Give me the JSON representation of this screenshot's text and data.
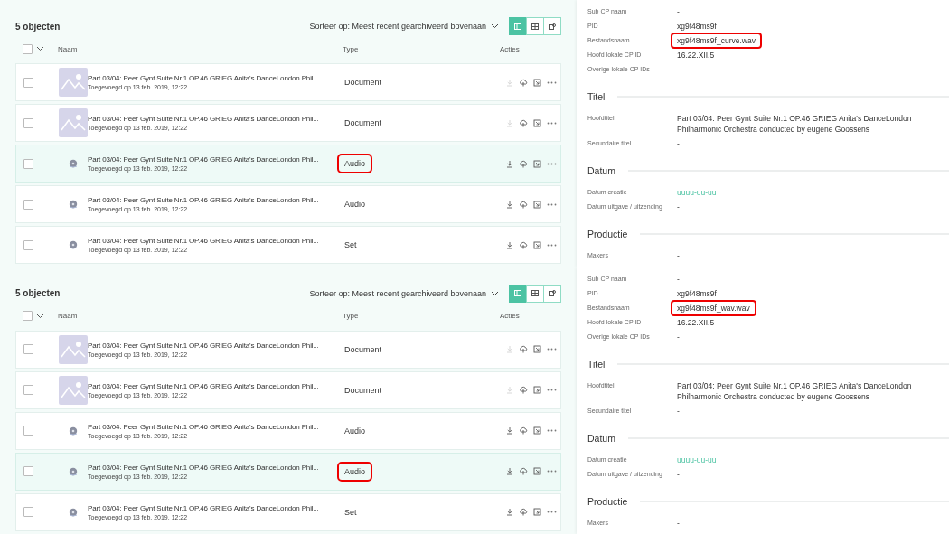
{
  "panels": [
    {
      "list": {
        "count": "5 objecten",
        "sort": "Sorteer op: Meest recent gearchiveerd bovenaan",
        "views": [
          {
            "kind": "list",
            "selected": true
          },
          {
            "kind": "grid",
            "selected": false
          },
          {
            "kind": "gallery",
            "selected": false
          }
        ],
        "select_all_checked": false,
        "columns": [
          "Naam",
          "Type",
          "Acties"
        ],
        "rows": [
          {
            "kind": "image",
            "checked": false,
            "title": "Part 03/04: Peer Gynt Suite Nr.1 OP.46 GRIEG Anita's DanceLondon Phil...",
            "added": "Toegevoegd op 13 feb. 2019, 12:22",
            "type": "Document",
            "selected": false,
            "highlighted": false,
            "download_disabled": true
          },
          {
            "kind": "image",
            "checked": false,
            "title": "Part 03/04: Peer Gynt Suite Nr.1 OP.46 GRIEG Anita's DanceLondon Phil...",
            "added": "Toegevoegd op 13 feb. 2019, 12:22",
            "type": "Document",
            "selected": false,
            "highlighted": false,
            "download_disabled": true
          },
          {
            "kind": "audio",
            "checked": false,
            "title": "Part 03/04: Peer Gynt Suite Nr.1 OP.46 GRIEG Anita's DanceLondon Phil...",
            "added": "Toegevoegd op 13 feb. 2019, 12:22",
            "type": "Audio",
            "selected": true,
            "highlighted": true,
            "download_disabled": false
          },
          {
            "kind": "audio",
            "checked": false,
            "title": "Part 03/04: Peer Gynt Suite Nr.1 OP.46 GRIEG Anita's DanceLondon Phil...",
            "added": "Toegevoegd op 13 feb. 2019, 12:22",
            "type": "Audio",
            "selected": false,
            "highlighted": false,
            "download_disabled": false
          },
          {
            "kind": "audio",
            "checked": false,
            "title": "Part 03/04: Peer Gynt Suite Nr.1 OP.46 GRIEG Anita's DanceLondon Phil...",
            "added": "Toegevoegd op 13 feb. 2019, 12:22",
            "type": "Set",
            "selected": false,
            "highlighted": false,
            "download_disabled": false
          }
        ]
      },
      "details": {
        "fields": [
          {
            "label": "Sub CP naam",
            "value": "-",
            "kind": "text",
            "highlighted": false
          },
          {
            "label": "PID",
            "value": "xg9f48ms9f",
            "kind": "text",
            "highlighted": false
          },
          {
            "label": "Bestandsnaam",
            "value": "xg9f48ms9f_curve.wav",
            "kind": "text",
            "highlighted": true
          },
          {
            "label": "Hoofd lokale CP ID",
            "value": "16.22.XII.5",
            "kind": "text",
            "highlighted": false
          },
          {
            "label": "Overige lokale CP IDs",
            "value": "-",
            "kind": "text",
            "highlighted": false
          }
        ],
        "sections": [
          {
            "title": "Titel",
            "fields": [
              {
                "label": "Hoofdtitel",
                "value": "Part 03/04: Peer Gynt Suite Nr.1 OP.46 GRIEG Anita's DanceLondon Philharmonic Orchestra conducted by eugene Goossens",
                "kind": "text",
                "highlighted": false
              },
              {
                "label": "Secundaire titel",
                "value": "-",
                "kind": "text",
                "highlighted": false
              }
            ]
          },
          {
            "title": "Datum",
            "fields": [
              {
                "label": "Datum creatie",
                "value": "uuuu-uu-uu",
                "kind": "link",
                "highlighted": false
              },
              {
                "label": "Datum uitgave / uitzending",
                "value": "-",
                "kind": "text",
                "highlighted": false
              }
            ]
          },
          {
            "title": "Productie",
            "fields": [
              {
                "label": "Makers",
                "value": "-",
                "kind": "text",
                "highlighted": false
              }
            ]
          }
        ]
      }
    },
    {
      "list": {
        "count": "5 objecten",
        "sort": "Sorteer op: Meest recent gearchiveerd bovenaan",
        "views": [
          {
            "kind": "list",
            "selected": true
          },
          {
            "kind": "grid",
            "selected": false
          },
          {
            "kind": "gallery",
            "selected": false
          }
        ],
        "select_all_checked": false,
        "columns": [
          "Naam",
          "Type",
          "Acties"
        ],
        "rows": [
          {
            "kind": "image",
            "checked": false,
            "title": "Part 03/04: Peer Gynt Suite Nr.1 OP.46 GRIEG Anita's DanceLondon Phil...",
            "added": "Toegevoegd op 13 feb. 2019, 12:22",
            "type": "Document",
            "selected": false,
            "highlighted": false,
            "download_disabled": true
          },
          {
            "kind": "image",
            "checked": false,
            "title": "Part 03/04: Peer Gynt Suite Nr.1 OP.46 GRIEG Anita's DanceLondon Phil...",
            "added": "Toegevoegd op 13 feb. 2019, 12:22",
            "type": "Document",
            "selected": false,
            "highlighted": false,
            "download_disabled": true
          },
          {
            "kind": "audio",
            "checked": false,
            "title": "Part 03/04: Peer Gynt Suite Nr.1 OP.46 GRIEG Anita's DanceLondon Phil...",
            "added": "Toegevoegd op 13 feb. 2019, 12:22",
            "type": "Audio",
            "selected": false,
            "highlighted": false,
            "download_disabled": false
          },
          {
            "kind": "audio",
            "checked": false,
            "title": "Part 03/04: Peer Gynt Suite Nr.1 OP.46 GRIEG Anita's DanceLondon Phil...",
            "added": "Toegevoegd op 13 feb. 2019, 12:22",
            "type": "Audio",
            "selected": true,
            "highlighted": true,
            "download_disabled": false
          },
          {
            "kind": "audio",
            "checked": false,
            "title": "Part 03/04: Peer Gynt Suite Nr.1 OP.46 GRIEG Anita's DanceLondon Phil...",
            "added": "Toegevoegd op 13 feb. 2019, 12:22",
            "type": "Set",
            "selected": false,
            "highlighted": false,
            "download_disabled": false
          }
        ]
      },
      "details": {
        "fields": [
          {
            "label": "Sub CP naam",
            "value": "-",
            "kind": "text",
            "highlighted": false
          },
          {
            "label": "PID",
            "value": "xg9f48ms9f",
            "kind": "text",
            "highlighted": false
          },
          {
            "label": "Bestandsnaam",
            "value": "xg9f48ms9f_wav.wav",
            "kind": "text",
            "highlighted": true
          },
          {
            "label": "Hoofd lokale CP ID",
            "value": "16.22.XII.5",
            "kind": "text",
            "highlighted": false
          },
          {
            "label": "Overige lokale CP IDs",
            "value": "-",
            "kind": "text",
            "highlighted": false
          }
        ],
        "sections": [
          {
            "title": "Titel",
            "fields": [
              {
                "label": "Hoofdtitel",
                "value": "Part 03/04: Peer Gynt Suite Nr.1 OP.46 GRIEG Anita's DanceLondon Philharmonic Orchestra conducted by eugene Goossens",
                "kind": "text",
                "highlighted": false
              },
              {
                "label": "Secundaire titel",
                "value": "-",
                "kind": "text",
                "highlighted": false
              }
            ]
          },
          {
            "title": "Datum",
            "fields": [
              {
                "label": "Datum creatie",
                "value": "uuuu-uu-uu",
                "kind": "link",
                "highlighted": false
              },
              {
                "label": "Datum uitgave / uitzending",
                "value": "-",
                "kind": "text",
                "highlighted": false
              }
            ]
          },
          {
            "title": "Productie",
            "fields": [
              {
                "label": "Makers",
                "value": "-",
                "kind": "text",
                "highlighted": false
              }
            ]
          }
        ]
      }
    }
  ]
}
